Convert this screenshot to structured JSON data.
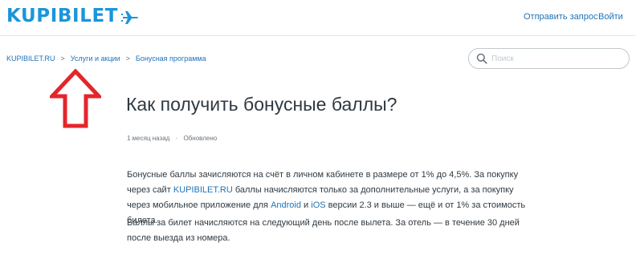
{
  "header": {
    "logo_text": "KUPIBILET",
    "logo_icon": "plane-icon",
    "nav": {
      "submit_request": "Отправить запрос",
      "login": "Войти"
    }
  },
  "breadcrumb": {
    "items": [
      "KUPIBILET.RU",
      "Услуги и акции",
      "Бонусная программа"
    ],
    "separator": ">"
  },
  "search": {
    "placeholder": "Поиск",
    "value": ""
  },
  "article": {
    "title": "Как получить бонусные баллы?",
    "meta": {
      "posted": "1 месяц назад",
      "dot": "·",
      "updated": "Обновлено"
    },
    "para1": {
      "t1": "Бонусные баллы зачисляются на счёт в личном кабинете в размере от 1% до 4,5%. За покупку через сайт ",
      "link_site": "KUPIBILET.RU",
      "t2": " баллы начисляются только за дополнительные услуги, а за покупку через мобильное приложение для ",
      "link_android": "Android",
      "t3": " и ",
      "link_ios": "iOS",
      "t4": " версии 2.3 и выше — ещё и от 1% за стоимость билета."
    },
    "para2": "Баллы за билет начисляются на следующий день после вылета. За отель — в течение 30 дней после выезда из номера."
  },
  "annotation": {
    "icon": "red-arrow-up-icon"
  },
  "colors": {
    "brand": "#1996db",
    "link": "#1f73b7",
    "text": "#2f3941",
    "muted": "#68737d",
    "annotation": "#e3262a"
  }
}
